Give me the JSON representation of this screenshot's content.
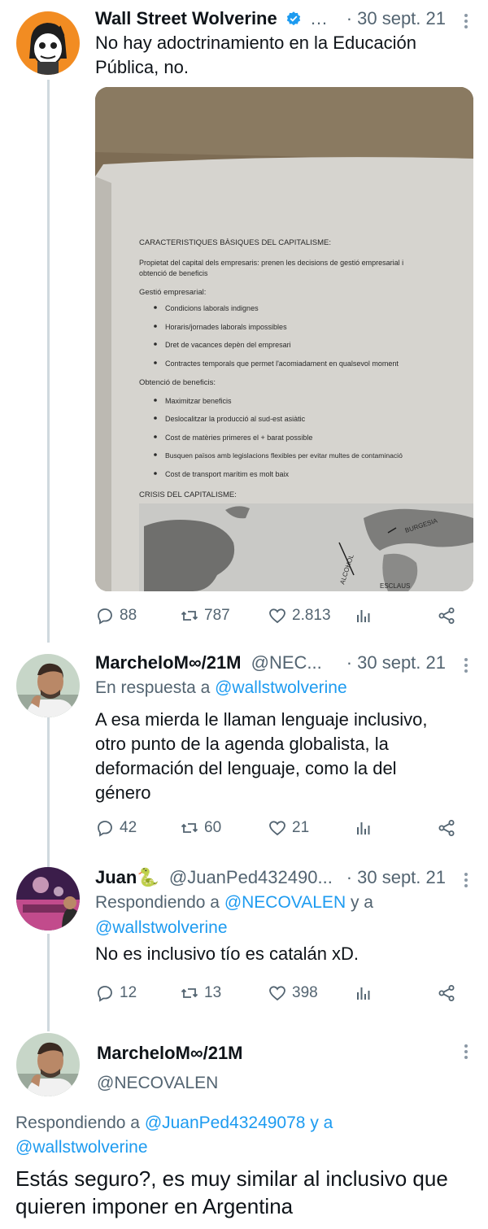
{
  "tweets": [
    {
      "name": "Wall Street Wolverine",
      "handle": "…",
      "time": "· 30 sept. 21",
      "text": "No hay adoctrinamiento en la Educación Pública, no.",
      "actions": {
        "replies": "88",
        "retweets": "787",
        "likes": "2.813"
      },
      "image": {
        "heading": "CARACTERISTIQUES BÀSIQUES DEL CAPITALISME:",
        "para1": "Propietat del capital dels empresaris: prenen les decisions de gestió empresarial i",
        "para1b": "obtenció de beneficis",
        "section1": "Gestió empresarial:",
        "bullets1": [
          "Condicions laborals indignes",
          "Horaris/jornades laborals impossibles",
          "Dret de vacances depèn del empresari",
          "Contractes temporals que permet l'acomiadament en qualsevol moment"
        ],
        "section2": "Obtenció de beneficis:",
        "bullets2": [
          "Maximitzar beneficis",
          "Deslocalitzar la producció al sud-est asiàtic",
          "Cost de matèries primeres el + barat possible",
          "Busquen països amb legislacions flexibles per evitar multes de contaminació",
          "Cost de transport marítim es molt baix"
        ],
        "crisis": "CRISIS DEL CAPITALISME:",
        "map_labels": [
          "BURGESIA",
          "ALCOHOL",
          "ESCLAUS"
        ]
      }
    },
    {
      "name": "MarcheloM∞/21M",
      "handle": "@NEC...",
      "time": "· 30 sept. 21",
      "reply_prefix": "En respuesta a",
      "reply_to": "@wallstwolverine",
      "text": "A esa mierda le llaman lenguaje inclusivo, otro punto de la agenda globalista, la deformación del lenguaje, como la del género",
      "actions": {
        "replies": "42",
        "retweets": "60",
        "likes": "21"
      }
    },
    {
      "name": "Juan🐍",
      "handle": "@JuanPed432490...",
      "time": "· 30 sept. 21",
      "reply_prefix": "Respondiendo a",
      "reply_to": "@NECOVALEN",
      "reply_and": "y a",
      "reply_to2": "@wallstwolverine",
      "text": "No es inclusivo tío es catalán xD.",
      "actions": {
        "replies": "12",
        "retweets": "13",
        "likes": "398"
      }
    },
    {
      "name": "MarcheloM∞/21M",
      "handle": "@NECOVALEN",
      "reply_prefix": "Respondiendo a",
      "reply_to": "@JuanPed43249078",
      "reply_and": "y a",
      "reply_to2": "@wallstwolverine",
      "text": "Estás seguro?, es muy similar al inclusivo que quieren imponer en Argentina"
    }
  ],
  "colors": {
    "link": "#1d9bf0",
    "muted": "#536471",
    "verified": "#1d9bf0",
    "thread": "#cfd9de"
  },
  "icons": [
    "reply-icon",
    "retweet-icon",
    "like-icon",
    "views-icon",
    "share-icon",
    "more-icon",
    "verified-icon"
  ]
}
